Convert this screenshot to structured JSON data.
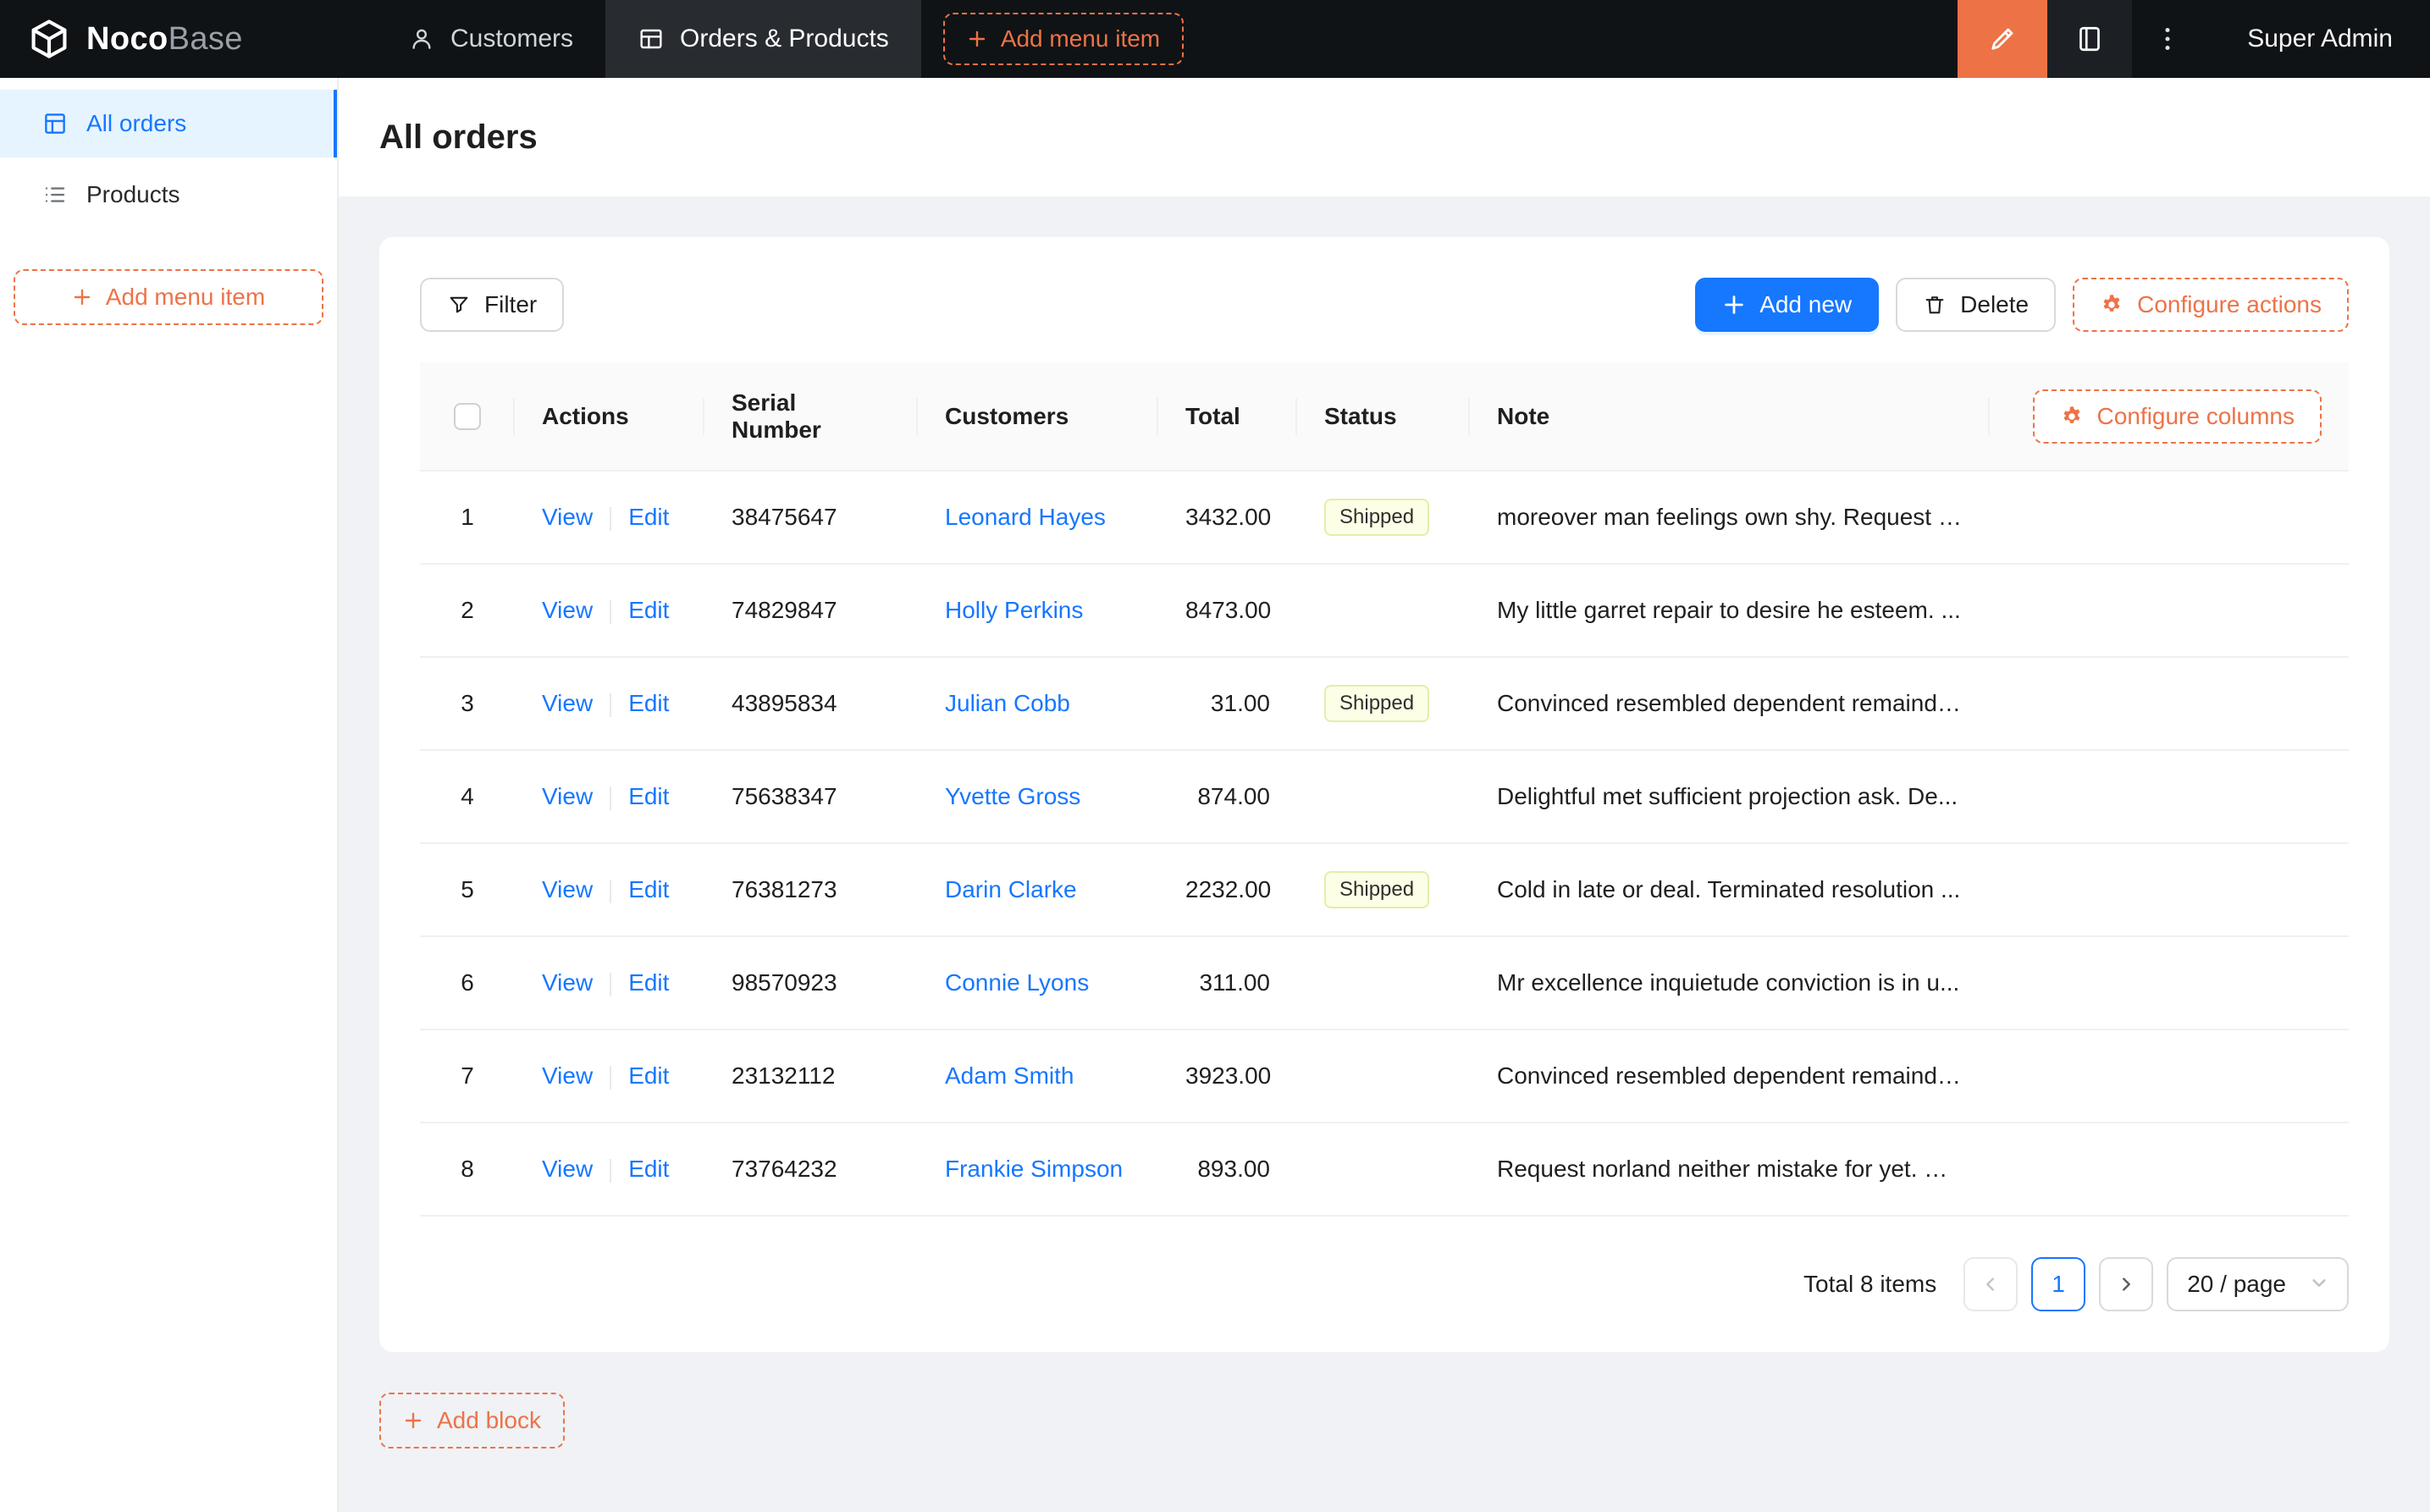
{
  "header": {
    "logo_noco": "Noco",
    "logo_base": "Base",
    "nav": [
      {
        "label": "Customers"
      },
      {
        "label": "Orders & Products"
      }
    ],
    "add_menu_item": "Add menu item",
    "user": "Super Admin"
  },
  "sidebar": {
    "items": [
      {
        "label": "All orders"
      },
      {
        "label": "Products"
      }
    ],
    "add_menu_item": "Add menu item"
  },
  "page": {
    "title": "All orders",
    "add_block": "Add block"
  },
  "toolbar": {
    "filter": "Filter",
    "add_new": "Add new",
    "delete": "Delete",
    "configure_actions": "Configure actions"
  },
  "table": {
    "configure_columns": "Configure columns",
    "columns": {
      "actions": "Actions",
      "serial": "Serial Number",
      "customers": "Customers",
      "total": "Total",
      "status": "Status",
      "note": "Note"
    },
    "actions": {
      "view": "View",
      "edit": "Edit"
    },
    "rows": [
      {
        "index": "1",
        "serial": "38475647",
        "customer": "Leonard Hayes",
        "total": "3432.00",
        "status": "Shipped",
        "note": "moreover man feelings own shy. Request n..."
      },
      {
        "index": "2",
        "serial": "74829847",
        "customer": "Holly Perkins",
        "total": "8473.00",
        "status": "",
        "note": "My little garret repair to desire he esteem. ..."
      },
      {
        "index": "3",
        "serial": "43895834",
        "customer": "Julian Cobb",
        "total": "31.00",
        "status": "Shipped",
        "note": "Convinced resembled dependent remainde..."
      },
      {
        "index": "4",
        "serial": "75638347",
        "customer": "Yvette Gross",
        "total": "874.00",
        "status": "",
        "note": "Delightful met sufficient projection ask. De..."
      },
      {
        "index": "5",
        "serial": "76381273",
        "customer": "Darin Clarke",
        "total": "2232.00",
        "status": "Shipped",
        "note": "Cold in late or deal. Terminated resolution ..."
      },
      {
        "index": "6",
        "serial": "98570923",
        "customer": "Connie Lyons",
        "total": "311.00",
        "status": "",
        "note": "Mr excellence inquietude conviction is in u..."
      },
      {
        "index": "7",
        "serial": "23132112",
        "customer": "Adam Smith",
        "total": "3923.00",
        "status": "",
        "note": "Convinced resembled dependent remainde..."
      },
      {
        "index": "8",
        "serial": "73764232",
        "customer": "Frankie Simpson",
        "total": "893.00",
        "status": "",
        "note": "Request norland neither mistake for yet. Be..."
      }
    ]
  },
  "pagination": {
    "total": "Total 8 items",
    "page": "1",
    "page_size": "20 / page"
  },
  "icons": {
    "logo-icon": "cube",
    "customers-icon": "person",
    "orders-products-icon": "table-grid",
    "highlighter-icon": "ui-editor-pen",
    "book-icon": "book",
    "vertical-ellipsis-icon": "three-dots",
    "all-orders-icon": "table-grid",
    "products-icon": "bulleted-list",
    "filter-icon": "funnel",
    "plus-icon": "plus",
    "trash-icon": "trash-can",
    "gear-icon": "settings-gear",
    "chevron-left-icon": "<",
    "chevron-right-icon": ">",
    "chevron-down-icon": "v"
  },
  "colors": {
    "primary": "#1677ff",
    "accent_orange": "#ed7347",
    "navbar_bg": "#101315",
    "nav_active_bg": "#282c30",
    "sidebar_active_bg": "#e6f4ff",
    "content_bg": "#f0f2f5",
    "tag_bg": "#fcffe6",
    "tag_border": "#e4edaa",
    "table_header_bg": "#fafafa"
  }
}
